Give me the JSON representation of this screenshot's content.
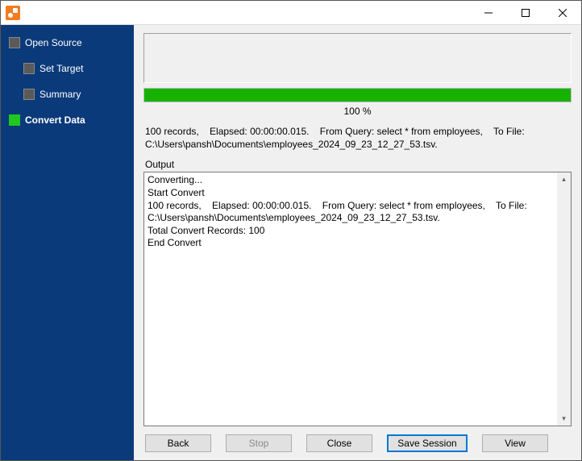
{
  "window": {
    "title": ""
  },
  "sidebar": {
    "items": [
      {
        "label": "Open Source",
        "active": false,
        "child": false
      },
      {
        "label": "Set Target",
        "active": false,
        "child": true
      },
      {
        "label": "Summary",
        "active": false,
        "child": true
      },
      {
        "label": "Convert Data",
        "active": true,
        "child": false
      }
    ]
  },
  "progress": {
    "percent": 100,
    "label": "100 %"
  },
  "status": "100 records,    Elapsed: 00:00:00.015.    From Query: select * from employees,    To File: C:\\Users\\pansh\\Documents\\employees_2024_09_23_12_27_53.tsv.",
  "output": {
    "label": "Output",
    "text": "Converting...\nStart Convert\n100 records,    Elapsed: 00:00:00.015.    From Query: select * from employees,    To File: C:\\Users\\pansh\\Documents\\employees_2024_09_23_12_27_53.tsv.\nTotal Convert Records: 100\nEnd Convert"
  },
  "buttons": {
    "back": "Back",
    "stop": "Stop",
    "close": "Close",
    "saveSession": "Save Session",
    "view": "View"
  }
}
